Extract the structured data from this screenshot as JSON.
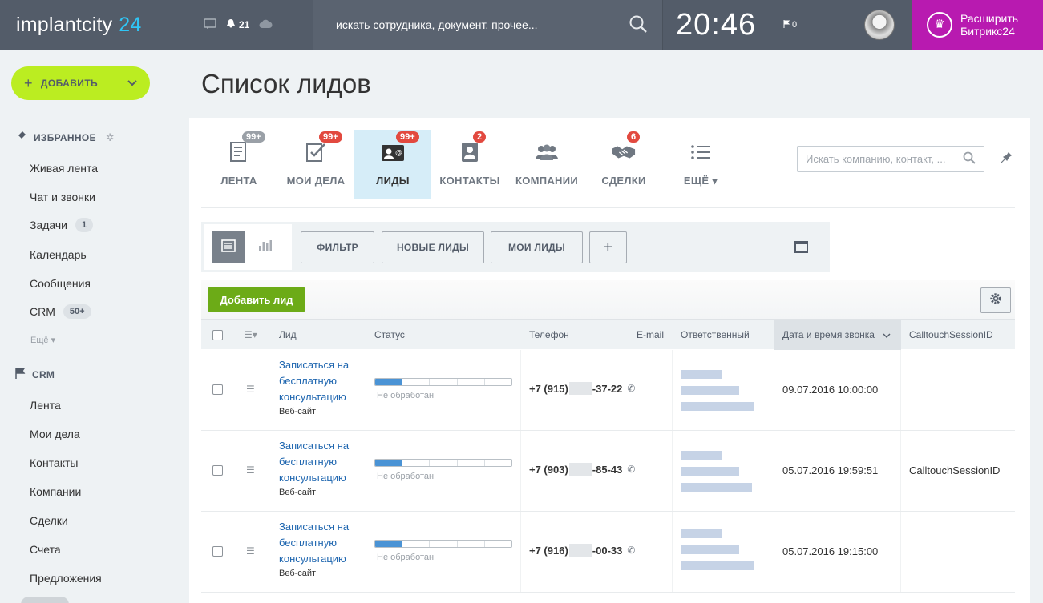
{
  "topbar": {
    "logo_text": "implantcity",
    "logo_num": "24",
    "notifications_count": "21",
    "search_placeholder": "искать сотрудника, документ, прочее...",
    "time": "20:46",
    "flag_count": "0",
    "expand_label_1": "Расширить",
    "expand_label_2": "Битрикс24"
  },
  "sidebar": {
    "add_button": "ДОБАВИТЬ",
    "favorites_title": "ИЗБРАННОЕ",
    "favorites": [
      {
        "label": "Живая лента"
      },
      {
        "label": "Чат и звонки"
      },
      {
        "label": "Задачи",
        "counter": "1"
      },
      {
        "label": "Календарь"
      },
      {
        "label": "Сообщения"
      },
      {
        "label": "CRM",
        "counter": "50+"
      }
    ],
    "more_label": "Ещё",
    "crm_title": "CRM",
    "crm_items": [
      {
        "label": "Лента"
      },
      {
        "label": "Мои дела"
      },
      {
        "label": "Контакты"
      },
      {
        "label": "Компании"
      },
      {
        "label": "Сделки"
      },
      {
        "label": "Счета"
      },
      {
        "label": "Предложения"
      }
    ]
  },
  "page": {
    "title": "Список лидов"
  },
  "crm_tabs": [
    {
      "label": "ЛЕНТА",
      "badge": "99+",
      "badge_color": "#9aa0a7",
      "icon": "feed-icon"
    },
    {
      "label": "МОИ ДЕЛА",
      "badge": "99+",
      "badge_color": "#e2493f",
      "icon": "tasks-icon"
    },
    {
      "label": "ЛИДЫ",
      "badge": "99+",
      "badge_color": "#e2493f",
      "icon": "leads-icon",
      "active": true
    },
    {
      "label": "КОНТАКТЫ",
      "badge": "2",
      "badge_color": "#e2493f",
      "icon": "contacts-icon"
    },
    {
      "label": "КОМПАНИИ",
      "badge": "",
      "icon": "companies-icon"
    },
    {
      "label": "СДЕЛКИ",
      "badge": "6",
      "badge_color": "#e2493f",
      "icon": "deals-icon"
    },
    {
      "label": "ЕЩЁ",
      "badge": "",
      "icon": "more-icon"
    }
  ],
  "crm_search_placeholder": "Искать компанию, контакт, ...",
  "filters": {
    "filter": "ФИЛЬТР",
    "new_leads": "НОВЫЕ ЛИДЫ",
    "my_leads": "МОИ ЛИДЫ",
    "add": "+"
  },
  "grid": {
    "add_lead": "Добавить лид",
    "columns": [
      "Лид",
      "Статус",
      "Телефон",
      "E-mail",
      "Ответственный",
      "Дата и время звонка",
      "CalltouchSessionID"
    ],
    "rows": [
      {
        "lead_1": "Записаться на",
        "lead_2": "бесплатную",
        "lead_3": "консультацию",
        "source": "Веб-сайт",
        "status": "Не обработан",
        "phone_prefix": "+7 (915)",
        "phone_suffix": "-37-22",
        "datetime": "09.07.2016 10:00:00",
        "session": ""
      },
      {
        "lead_1": "Записаться на",
        "lead_2": "бесплатную",
        "lead_3": "консультацию",
        "source": "Веб-сайт",
        "status": "Не обработан",
        "phone_prefix": "+7 (903)",
        "phone_suffix": "-85-43",
        "datetime": "05.07.2016 19:59:51",
        "session": "CalltouchSessionID"
      },
      {
        "lead_1": "Записаться на",
        "lead_2": "бесплатную",
        "lead_3": "консультацию",
        "source": "Веб-сайт",
        "status": "Не обработан",
        "phone_prefix": "+7 (916)",
        "phone_suffix": "-00-33",
        "datetime": "05.07.2016 19:15:00",
        "session": ""
      }
    ],
    "status_progress_fraction": 0.2
  },
  "colors": {
    "topbar": "#535c69",
    "accent_blue": "#2fc6f6",
    "add_green": "#bbed21",
    "expand_purple": "#b81ab0",
    "add_lead_green": "#6cab17",
    "badge_red": "#e2493f"
  }
}
